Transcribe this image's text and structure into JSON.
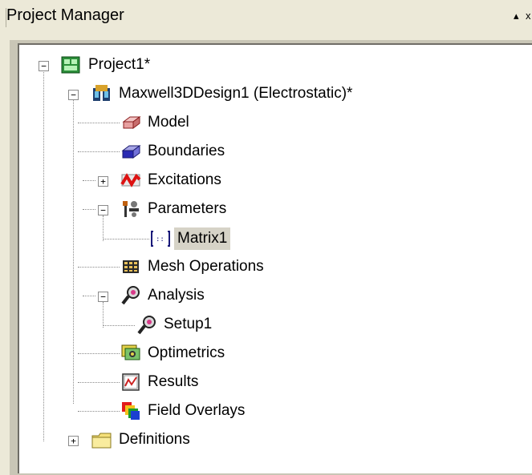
{
  "panel": {
    "title": "Project Manager",
    "pin_glyph": "▴",
    "close_glyph": "x"
  },
  "tree": {
    "project": {
      "label": "Project1*",
      "expanded": true,
      "icon": "project-icon"
    },
    "design": {
      "label": "Maxwell3DDesign1 (Electrostatic)*",
      "expanded": true,
      "icon": "maxwell-design-icon"
    },
    "items": [
      {
        "label": "Model",
        "icon": "model-icon"
      },
      {
        "label": "Boundaries",
        "icon": "boundaries-icon"
      },
      {
        "label": "Excitations",
        "icon": "excitations-icon",
        "expander": "+"
      },
      {
        "label": "Parameters",
        "icon": "parameters-icon",
        "expander": "−"
      },
      {
        "label": "Matrix1",
        "icon": "matrix-icon",
        "selected": true
      },
      {
        "label": "Mesh Operations",
        "icon": "mesh-operations-icon"
      },
      {
        "label": "Analysis",
        "icon": "analysis-icon",
        "expander": "−"
      },
      {
        "label": "Setup1",
        "icon": "setup-icon"
      },
      {
        "label": "Optimetrics",
        "icon": "optimetrics-icon"
      },
      {
        "label": "Results",
        "icon": "results-icon"
      },
      {
        "label": "Field Overlays",
        "icon": "field-overlays-icon"
      }
    ],
    "definitions": {
      "label": "Definitions",
      "expander": "+",
      "icon": "folder-icon"
    }
  },
  "colors": {
    "chrome": "#ece9d8",
    "tree_bg": "#ffffff",
    "selection": "#d6d3c7"
  }
}
